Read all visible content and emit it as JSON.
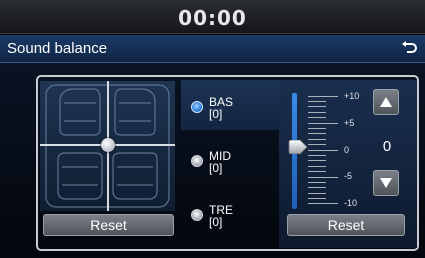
{
  "status_bar": {
    "time": "00:00"
  },
  "header": {
    "title": "Sound balance"
  },
  "balance": {
    "reset_label": "Reset"
  },
  "tone": {
    "options": [
      {
        "label": "BAS",
        "value": "[0]",
        "selected": true
      },
      {
        "label": "MID",
        "value": "[0]",
        "selected": false
      },
      {
        "label": "TRE",
        "value": "[0]",
        "selected": false
      }
    ],
    "scale_labels": [
      "+10",
      "+5",
      "0",
      "-5",
      "-10"
    ],
    "current_level": "0",
    "reset_label": "Reset"
  },
  "colors": {
    "accent": "#2a7ad8",
    "header": "#1c3a66"
  },
  "icons": {
    "back": "back-arrow-icon",
    "up": "up-arrow-icon",
    "down": "down-arrow-icon"
  }
}
